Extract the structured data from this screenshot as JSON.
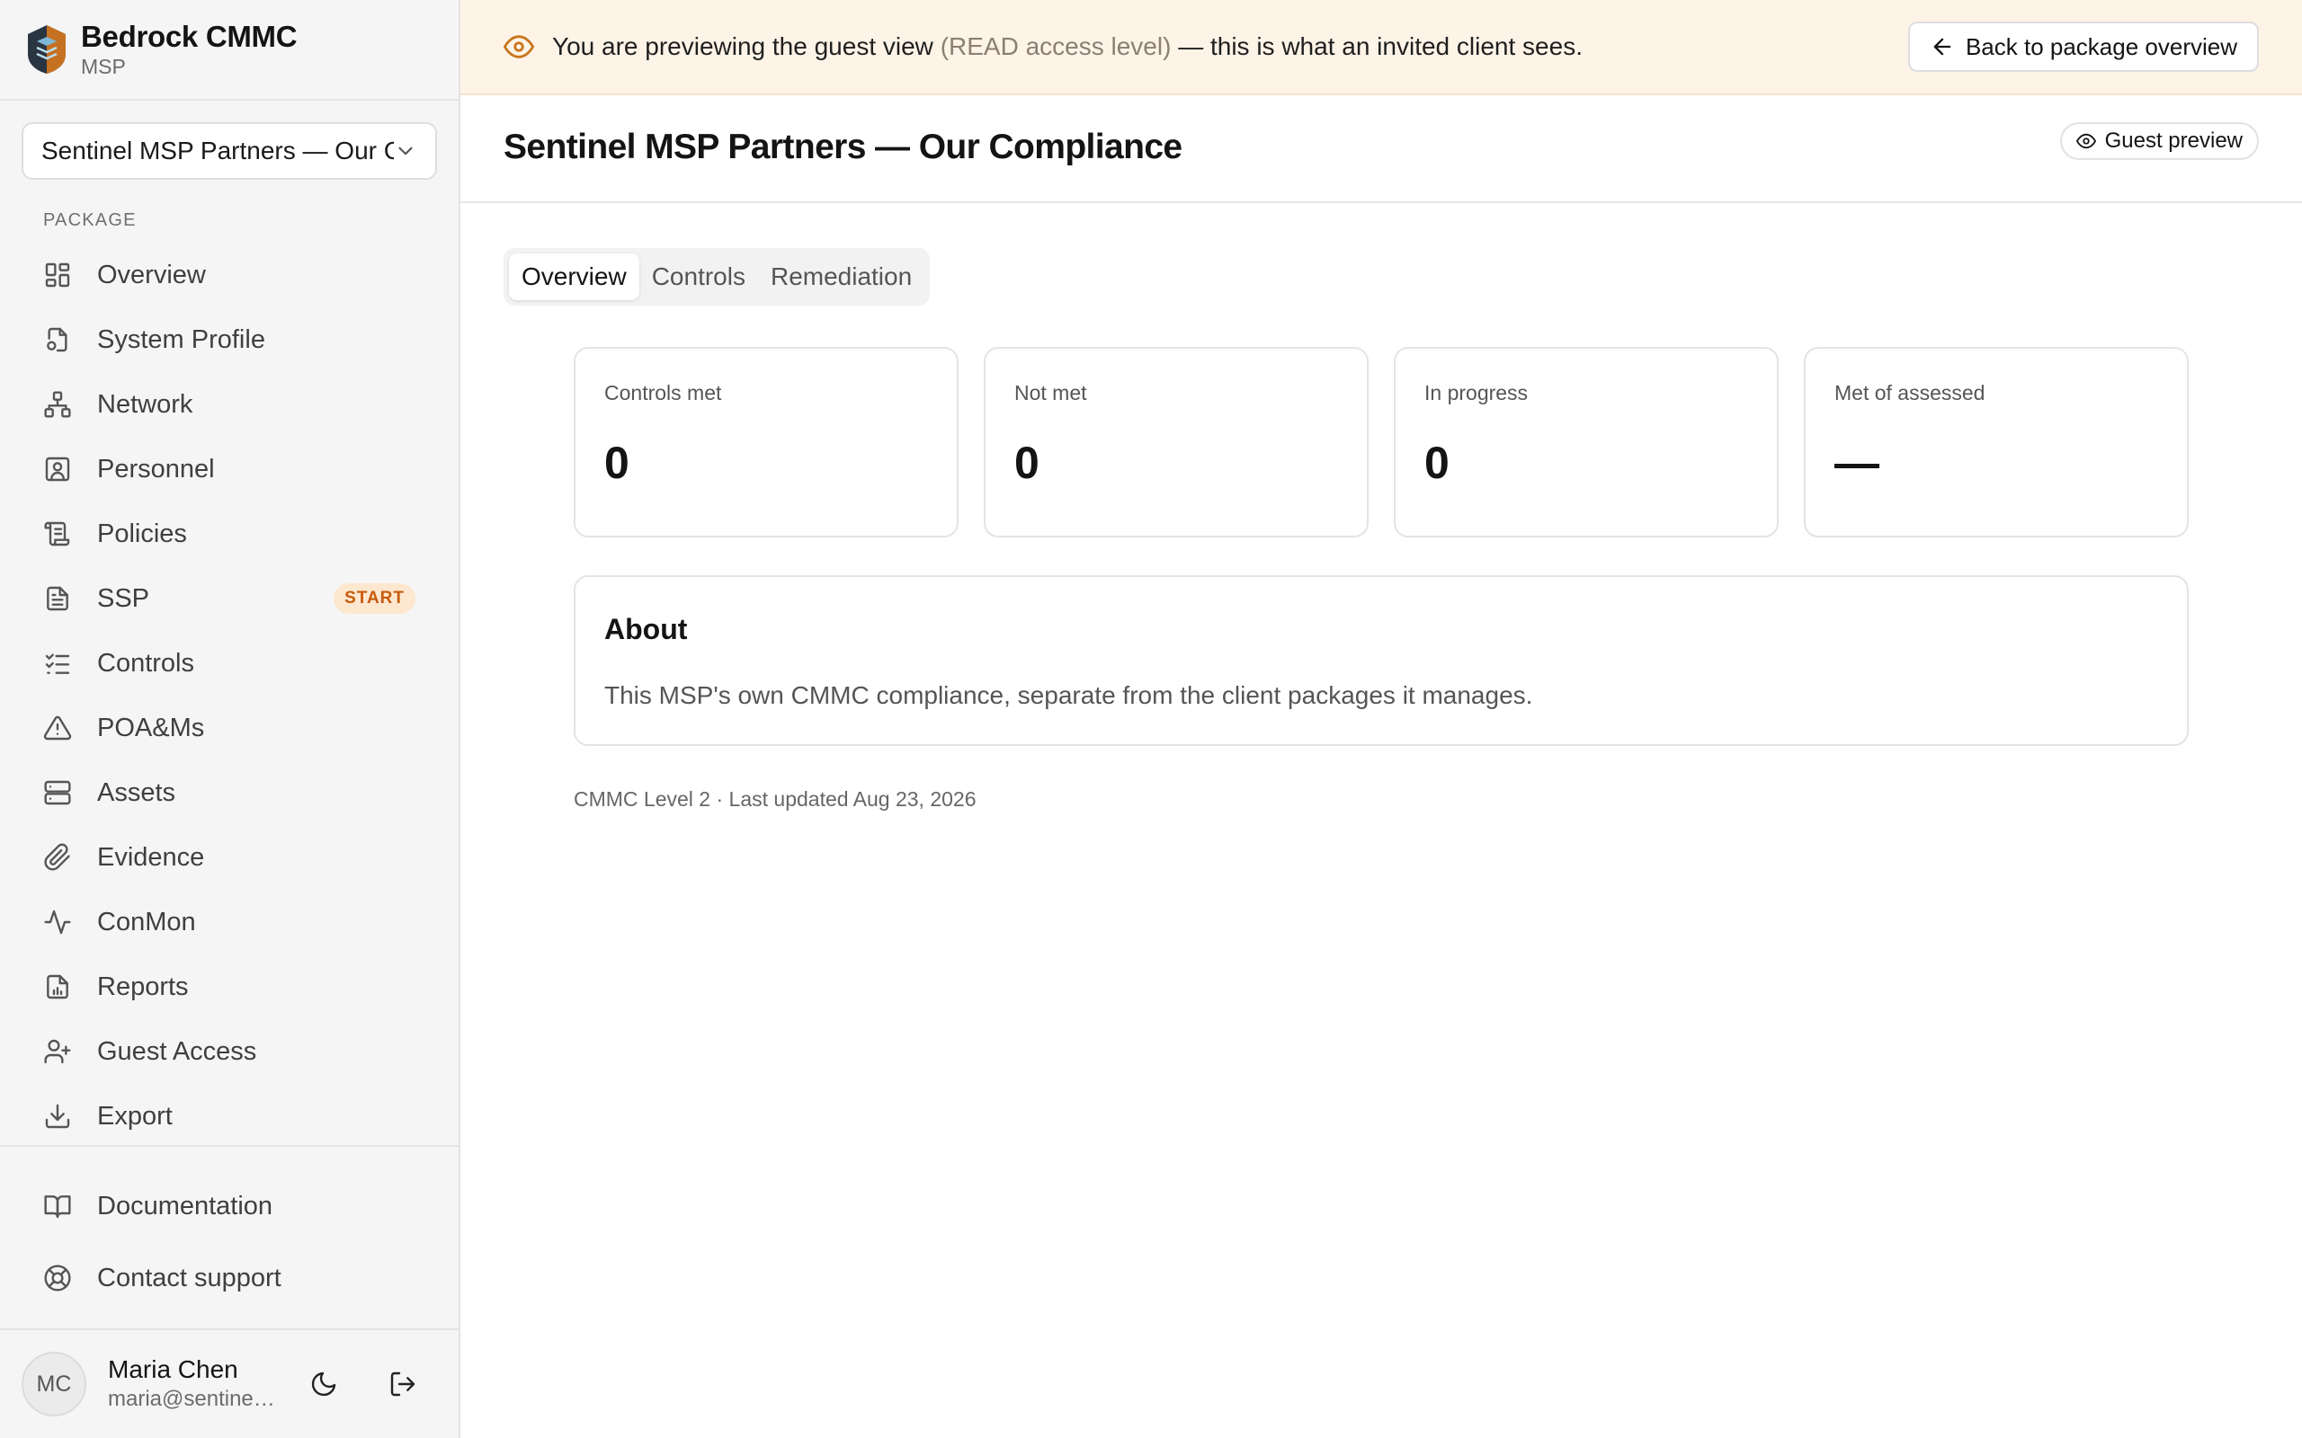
{
  "brand": {
    "name": "Bedrock CMMC",
    "subtitle": "MSP"
  },
  "package_select": {
    "value": "Sentinel MSP Partners — Our Compliance"
  },
  "sidebar": {
    "section_label": "PACKAGE",
    "items": [
      {
        "label": "Overview",
        "icon": "layout-grid-icon"
      },
      {
        "label": "System Profile",
        "icon": "file-settings-icon"
      },
      {
        "label": "Network",
        "icon": "network-icon"
      },
      {
        "label": "Personnel",
        "icon": "user-square-icon"
      },
      {
        "label": "Policies",
        "icon": "scroll-icon"
      },
      {
        "label": "SSP",
        "icon": "file-text-icon",
        "badge": "START"
      },
      {
        "label": "Controls",
        "icon": "list-checks-icon"
      },
      {
        "label": "POA&Ms",
        "icon": "alert-triangle-icon"
      },
      {
        "label": "Assets",
        "icon": "server-icon"
      },
      {
        "label": "Evidence",
        "icon": "paperclip-icon"
      },
      {
        "label": "ConMon",
        "icon": "activity-icon"
      },
      {
        "label": "Reports",
        "icon": "file-chart-icon"
      },
      {
        "label": "Guest Access",
        "icon": "user-plus-icon"
      },
      {
        "label": "Export",
        "icon": "download-icon"
      }
    ],
    "footer_items": [
      {
        "label": "Documentation",
        "icon": "book-open-icon"
      },
      {
        "label": "Contact support",
        "icon": "life-buoy-icon"
      }
    ]
  },
  "user": {
    "initials": "MC",
    "name": "Maria Chen",
    "email": "maria@sentinelmsp.com"
  },
  "banner": {
    "text_start": "You are previewing the guest view",
    "text_access": "(READ access level)",
    "text_end": "— this is what an invited client sees.",
    "back_label": "Back to package overview"
  },
  "page": {
    "title": "Sentinel MSP Partners — Our Compliance",
    "chip": "Guest preview"
  },
  "tabs": [
    {
      "label": "Overview",
      "active": true
    },
    {
      "label": "Controls",
      "active": false
    },
    {
      "label": "Remediation",
      "active": false
    }
  ],
  "stats": [
    {
      "label": "Controls met",
      "value": "0"
    },
    {
      "label": "Not met",
      "value": "0"
    },
    {
      "label": "In progress",
      "value": "0"
    },
    {
      "label": "Met of assessed",
      "value": "—"
    }
  ],
  "about": {
    "title": "About",
    "text": "This MSP's own CMMC compliance, separate from the client packages it manages."
  },
  "meta": "CMMC Level 2 · Last updated Aug 23, 2026",
  "colors": {
    "accent": "#c9761c",
    "badge_bg": "#fde7cf",
    "badge_text": "#c75a0a",
    "banner_bg": "#fdf3e7"
  }
}
